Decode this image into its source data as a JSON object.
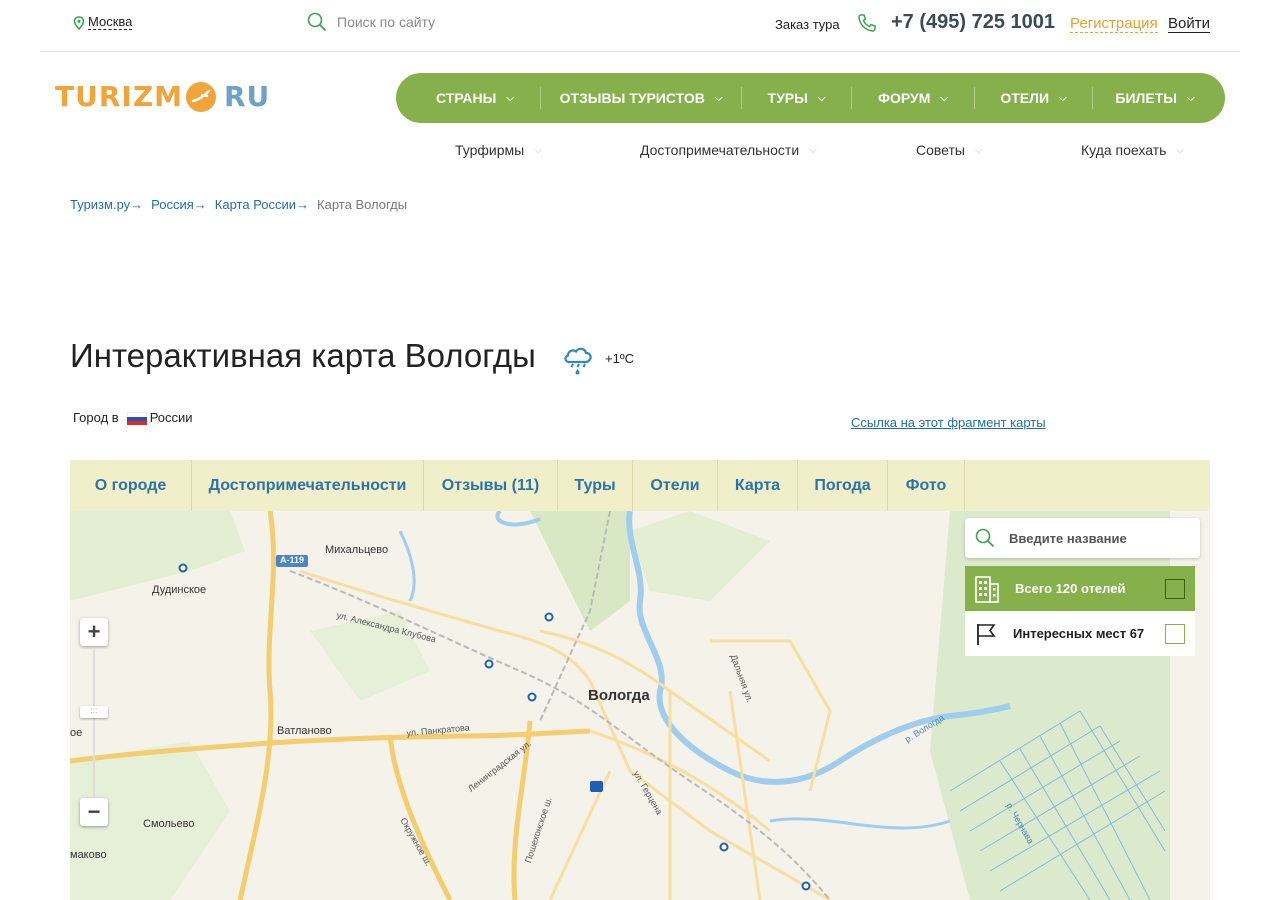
{
  "topbar": {
    "city": "Москва",
    "search_placeholder": "Поиск по сайту",
    "order_tour": "Заказ тура",
    "phone": "+7 (495) 725 1001",
    "register": "Регистрация",
    "login": "Войти"
  },
  "logo": {
    "left": "TURIZM",
    "right": "RU"
  },
  "main_nav": [
    {
      "label": "СТРАНЫ"
    },
    {
      "label": "ОТЗЫВЫ ТУРИСТОВ"
    },
    {
      "label": "ТУРЫ"
    },
    {
      "label": "ФОРУМ"
    },
    {
      "label": "ОТЕЛИ"
    },
    {
      "label": "БИЛЕТЫ"
    }
  ],
  "sub_nav": [
    {
      "label": "Турфирмы"
    },
    {
      "label": "Достопримечательности"
    },
    {
      "label": "Советы"
    },
    {
      "label": "Куда поехать"
    }
  ],
  "breadcrumb": {
    "items": [
      "Туризм.ру",
      "Россия",
      "Карта России"
    ],
    "separator": "→",
    "current": "Карта Вологды"
  },
  "page": {
    "title": "Интерактивная карта Вологды",
    "temperature": "+1ºC",
    "country_prefix": "Город в",
    "country": "России",
    "link_fragment": "Ссылка на этот фрагмент карты"
  },
  "tabs": [
    {
      "label": "О городе"
    },
    {
      "label": "Достопримечательности"
    },
    {
      "label": "Отзывы (11)"
    },
    {
      "label": "Туры"
    },
    {
      "label": "Отели"
    },
    {
      "label": "Карта"
    },
    {
      "label": "Погода"
    },
    {
      "label": "Фото"
    }
  ],
  "map": {
    "labels": {
      "city": "Вологда",
      "mihalcevo": "Михальцево",
      "dudinskoe": "Дудинское",
      "vatlanovo": "Ватланово",
      "smolevo": "Смольево",
      "oe": "ое",
      "makovo": "маково",
      "road_a119": "А-119",
      "klubova": "ул. Александра Клубова",
      "pankratova": "ул. Панкратова",
      "leningradskaya": "Ленинградская ул.",
      "okruzhnoe": "Окружное ш.",
      "poshekhonskoe": "Пошехонское ш.",
      "gertsena": "ул. Герцена",
      "dalnyaya": "Дальняя ул.",
      "river_vologda": "р. Вологда",
      "river_chernava": "р. Чернава"
    },
    "search_placeholder": "Введите название",
    "hotels_label": "Всего 120 отелей",
    "places_label": "Интересных мест 67"
  },
  "colors": {
    "nav_green": "#86b04c",
    "accent_orange": "#f0a43a",
    "link_blue": "#1f6fa5",
    "tab_bg": "#f1efc9"
  }
}
